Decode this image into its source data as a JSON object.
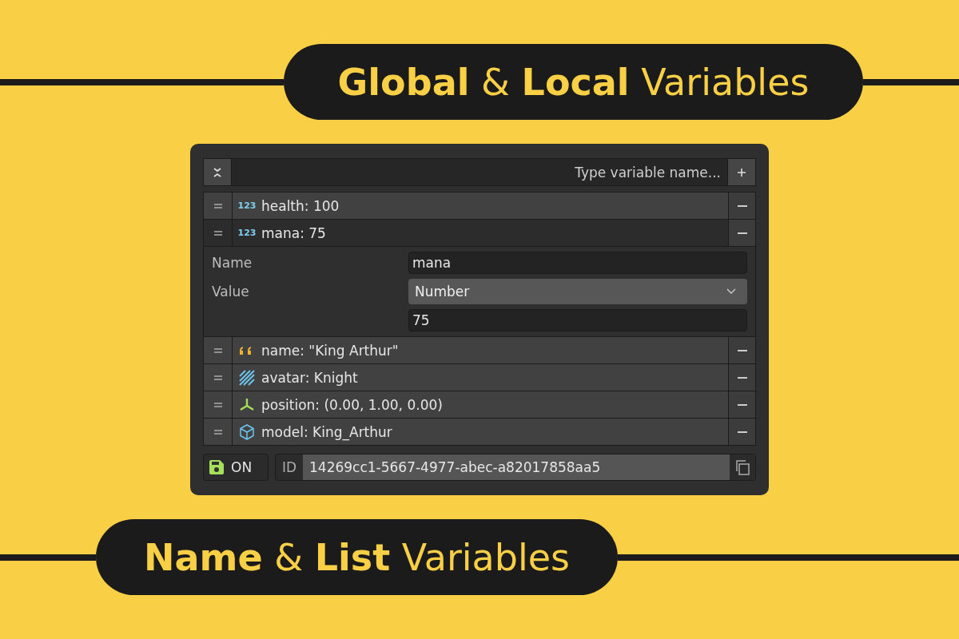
{
  "headline": "**Global** & **Local** Variables",
  "panel": {
    "search": {
      "placeholder": "Type variable name..."
    },
    "variables": [
      {
        "kind": "number",
        "badge": "123",
        "label": "health: 100",
        "expanded": false
      },
      {
        "kind": "number",
        "badge": "123",
        "label": "mana: 75",
        "expanded": true,
        "details": {
          "name_label": "Name",
          "name_value": "mana",
          "value_label": "Value",
          "value_type": "Number",
          "value": "75"
        }
      },
      {
        "kind": "string",
        "label": "name: \"King Arthur\"",
        "expanded": false
      },
      {
        "kind": "texture",
        "label": "avatar: Knight",
        "expanded": false
      },
      {
        "kind": "vector",
        "label": "position: (0.00, 1.00, 0.00)",
        "expanded": false
      },
      {
        "kind": "object",
        "label": "model: King_Arthur",
        "expanded": false
      }
    ],
    "save": {
      "label": "ON",
      "on": true
    },
    "id": {
      "label": "ID",
      "value": "14269cc1-5667-4977-abec-a82017858aa5"
    }
  },
  "footline": "**Name** & **List** Variables"
}
